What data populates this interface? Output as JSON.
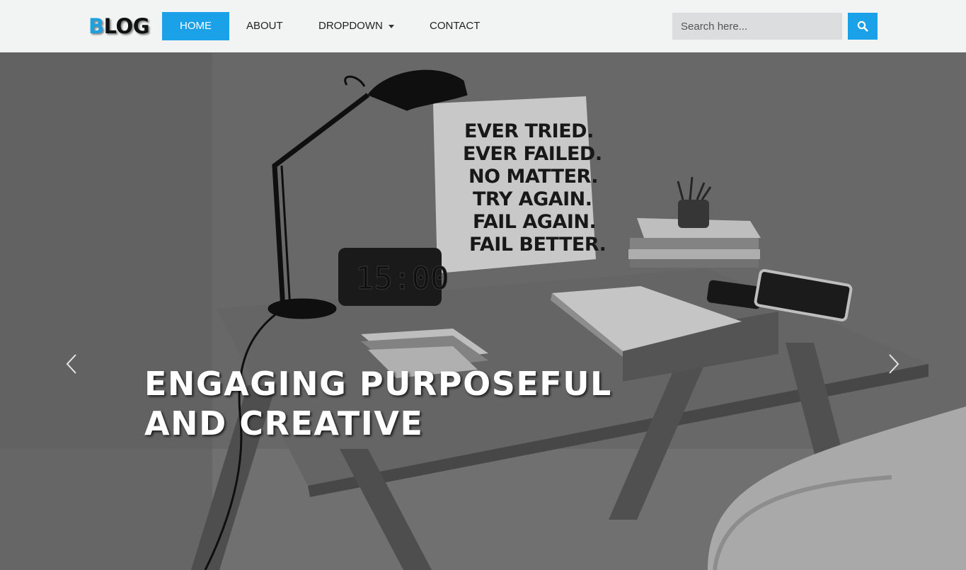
{
  "brand": {
    "first_letter": "B",
    "rest": "LOG"
  },
  "nav": {
    "items": [
      {
        "label": "HOME",
        "active": true
      },
      {
        "label": "ABOUT",
        "active": false
      },
      {
        "label": "DROPDOWN",
        "active": false,
        "has_caret": true
      },
      {
        "label": "CONTACT",
        "active": false
      }
    ]
  },
  "search": {
    "placeholder": "Search here...",
    "value": "",
    "button_icon": "search-icon"
  },
  "hero": {
    "headline_line1": "ENGAGING PURPOSEFUL",
    "headline_line2": "AND CREATIVE",
    "poster_lines": [
      "EVER TRIED.",
      "EVER FAILED.",
      "NO MATTER.",
      "TRY AGAIN.",
      "FAIL AGAIN.",
      "FAIL BETTER."
    ],
    "clock": "15:00",
    "prev_icon": "chevron-left-icon",
    "next_icon": "chevron-right-icon"
  },
  "colors": {
    "accent": "#1aa1e8",
    "navbar_bg": "#f2f3f3",
    "headline": "#ffffff"
  }
}
